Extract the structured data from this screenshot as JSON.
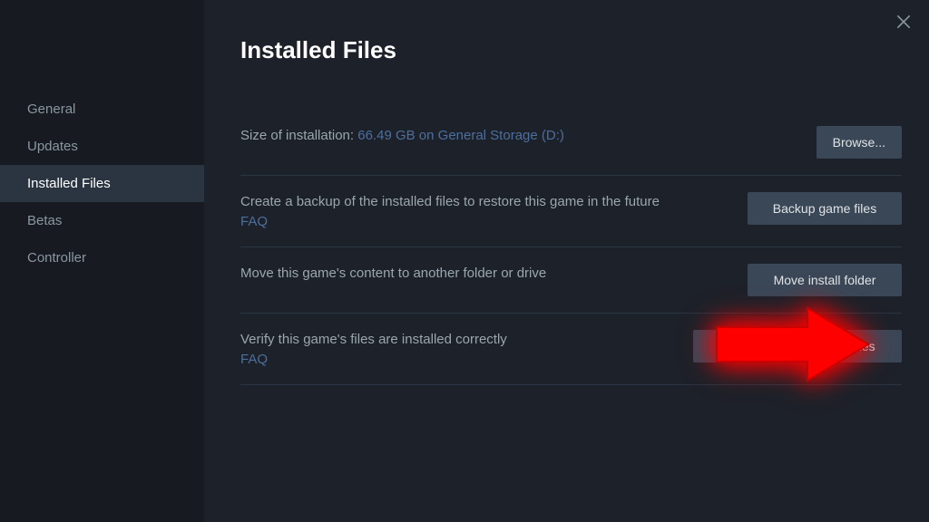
{
  "sidebar": {
    "items": [
      {
        "label": "General",
        "id": "general"
      },
      {
        "label": "Updates",
        "id": "updates"
      },
      {
        "label": "Installed Files",
        "id": "installed-files"
      },
      {
        "label": "Betas",
        "id": "betas"
      },
      {
        "label": "Controller",
        "id": "controller"
      }
    ],
    "active_index": 2
  },
  "main": {
    "title": "Installed Files",
    "rows": {
      "size": {
        "prefix": "Size of installation: ",
        "link": "66.49 GB on General Storage (D:)",
        "button": "Browse..."
      },
      "backup": {
        "text": "Create a backup of the installed files to restore this game in the future",
        "faq": "FAQ",
        "button": "Backup game files"
      },
      "move": {
        "text": "Move this game's content to another folder or drive",
        "button": "Move install folder"
      },
      "verify": {
        "text": "Verify this game's files are installed correctly",
        "faq": "FAQ",
        "button": "Verify integrity of game files"
      }
    }
  },
  "colors": {
    "link": "#4c6f9e",
    "arrow": "#ff0000"
  }
}
